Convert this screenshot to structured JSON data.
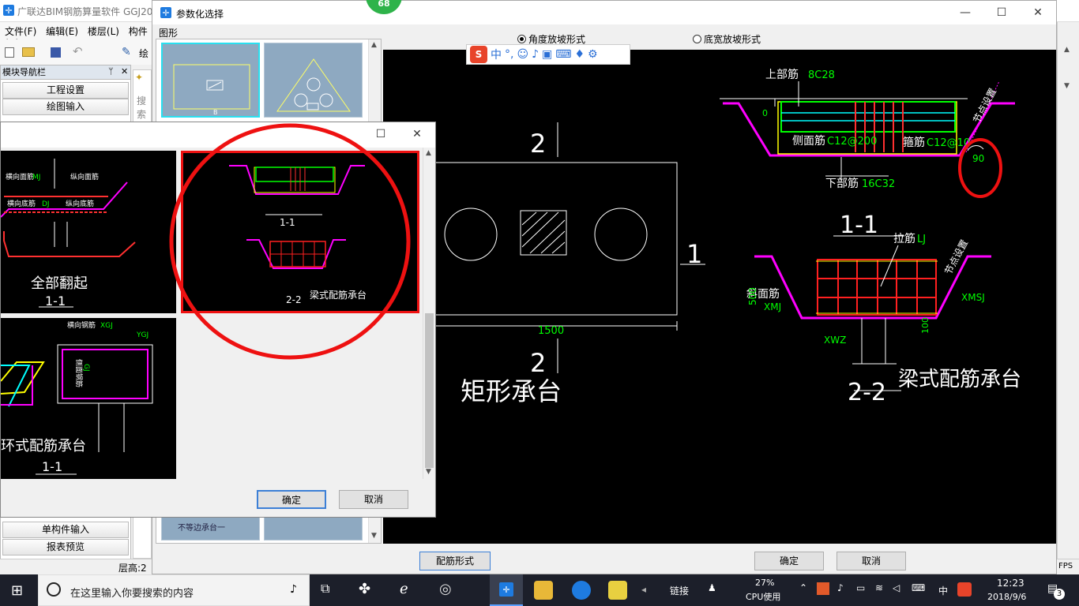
{
  "app": {
    "title": "广联达BIM钢筋算量软件 GGJ20",
    "menus": [
      "文件(F)",
      "编辑(E)",
      "楼层(L)",
      "构件(N)"
    ],
    "toolbar_partial": "绘"
  },
  "nav": {
    "title": "模块导航栏",
    "pin": "ᛘ",
    "close": "✕",
    "items_top": [
      "工程设置",
      "绘图输入"
    ],
    "items_bottom": [
      "单构件输入",
      "报表预览"
    ],
    "search_partial": "搜索"
  },
  "status": {
    "floor": "层高:2",
    "fps": "FPS"
  },
  "badge": {
    "value": "68"
  },
  "param_window": {
    "title": "参数化选择",
    "shapes_label": "图形",
    "radio_angle": "角度放坡形式",
    "radio_width": "底宽放坡形式",
    "buttons": {
      "rebar_form": "配筋形式",
      "ok": "确定",
      "cancel": "取消"
    },
    "thumb_labels": {
      "b": "B",
      "bottom": "不等边承台一"
    }
  },
  "preview": {
    "rect_title": "矩形承台",
    "beam_title": "梁式配筋承台",
    "sec2": "2",
    "sec1": "1",
    "dim1500": "1500",
    "sec11": "1-1",
    "sec22": "2-2",
    "top_bar_lbl": "上部筋",
    "top_bar_val": "8C28",
    "side_lbl": "侧面筋",
    "side_val": "C12@200",
    "stirrup_lbl": "箍筋",
    "stirrup_val": "C12@10",
    "bottom_lbl": "下部筋",
    "bottom_val": "16C32",
    "node_setting": "节点设置",
    "angle": "90",
    "tie_lbl": "拉筋",
    "tie_val": "LJ",
    "slope_lbl": "斜面筋",
    "xmj": "XMJ",
    "xmsj": "XMSJ",
    "xwz": "XWZ",
    "dim500": "500",
    "dim0": "0",
    "dim100": "100"
  },
  "ime": {
    "s": "S",
    "cn": "中",
    "dot": "°,"
  },
  "dialog": {
    "ok": "确定",
    "cancel": "取消",
    "cells": {
      "all_up": "全部翻起",
      "sec11": "1-1",
      "sec22": "2-2",
      "beam": "梁式配筋承台",
      "ring": "环式配筋承台",
      "h_face": "横向面筋",
      "v_face": "纵向面筋",
      "h_bottom": "横向底筋",
      "v_bottom": "纵向底筋",
      "h_ring": "横向钢筋",
      "side_ring": "侧面钢筋",
      "mj": "MJ",
      "xgj": "XGJ",
      "ygj": "YGJ",
      "dj": "DJ",
      "gj": "GJ"
    }
  },
  "taskbar": {
    "search_placeholder": "在这里输入你要搜索的内容",
    "link": "链接",
    "cpu_pct": "27%",
    "cpu_lbl": "CPU使用",
    "ime_cn": "中",
    "time": "12:23",
    "date": "2018/9/6",
    "notif": "3"
  },
  "colors": {
    "cad_bg": "#000000",
    "cad_green": "#00ff00",
    "cad_magenta": "#ff00ff",
    "cad_red": "#ff0000",
    "cad_yellow": "#ffff00",
    "cad_cyan": "#00ffff",
    "highlight_red": "#ee1111",
    "accent_blue": "#1e7be0"
  }
}
